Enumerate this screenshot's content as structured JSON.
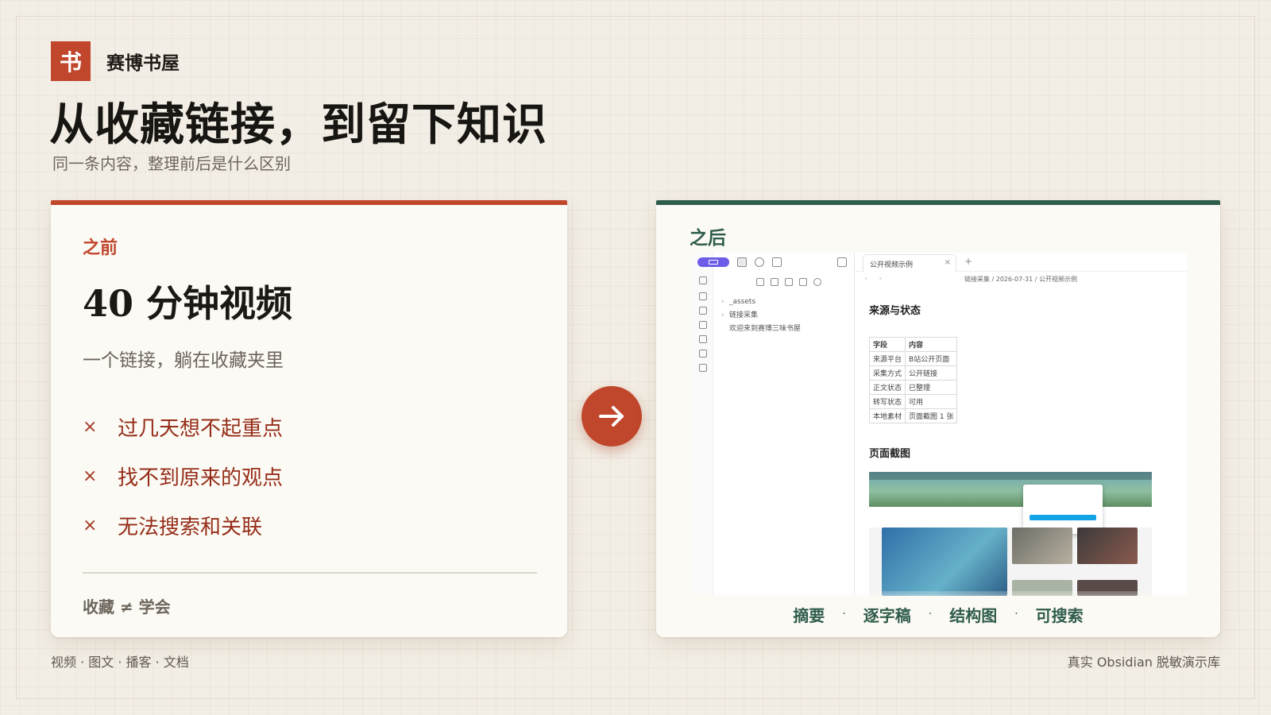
{
  "brand": {
    "mark": "书",
    "name": "赛博书屋"
  },
  "title": "从收藏链接，到留下知识",
  "subtitle": "同一条内容，整理前后是什么区别",
  "before": {
    "label": "之前",
    "headline": "40 分钟视频",
    "desc": "一个链接，躺在收藏夹里",
    "points": [
      {
        "mark": "×",
        "text": "过几天想不起重点"
      },
      {
        "mark": "×",
        "text": "找不到原来的观点"
      },
      {
        "mark": "×",
        "text": "无法搜索和关联"
      }
    ],
    "foot": "收藏 ≠ 学会"
  },
  "after": {
    "label": "之后",
    "obsidian": {
      "tree": {
        "assets": "_assets",
        "folder": "链接采集",
        "welcome": "欢迎来到赛博三味书屋"
      },
      "tab": {
        "title": "公开视频示例",
        "close": "×",
        "plus": "+"
      },
      "breadcrumb": "链接采集 / 2026-07-31 / 公开视频示例",
      "nav_arrows": "‹ ›",
      "section1": "来源与状态",
      "table": [
        [
          "字段",
          "内容"
        ],
        [
          "来源平台",
          "B站公开页面"
        ],
        [
          "采集方式",
          "公开链接"
        ],
        [
          "正文状态",
          "已整理"
        ],
        [
          "转写状态",
          "可用"
        ],
        [
          "本地素材",
          "页面截图 1 张"
        ]
      ],
      "section2": "页面截图"
    },
    "features": [
      "摘要",
      "逐字稿",
      "结构图",
      "可搜索"
    ],
    "separator": "·"
  },
  "footer": {
    "left": "视频 · 图文 · 播客 · 文档",
    "right": "真实 Obsidian 脱敏演示库"
  },
  "colors": {
    "accent": "#c0472c",
    "green": "#2f5d4c",
    "background": "#f3eee5"
  },
  "icons": [
    "arrow-right-icon",
    "close-icon",
    "chevron-right-icon"
  ]
}
